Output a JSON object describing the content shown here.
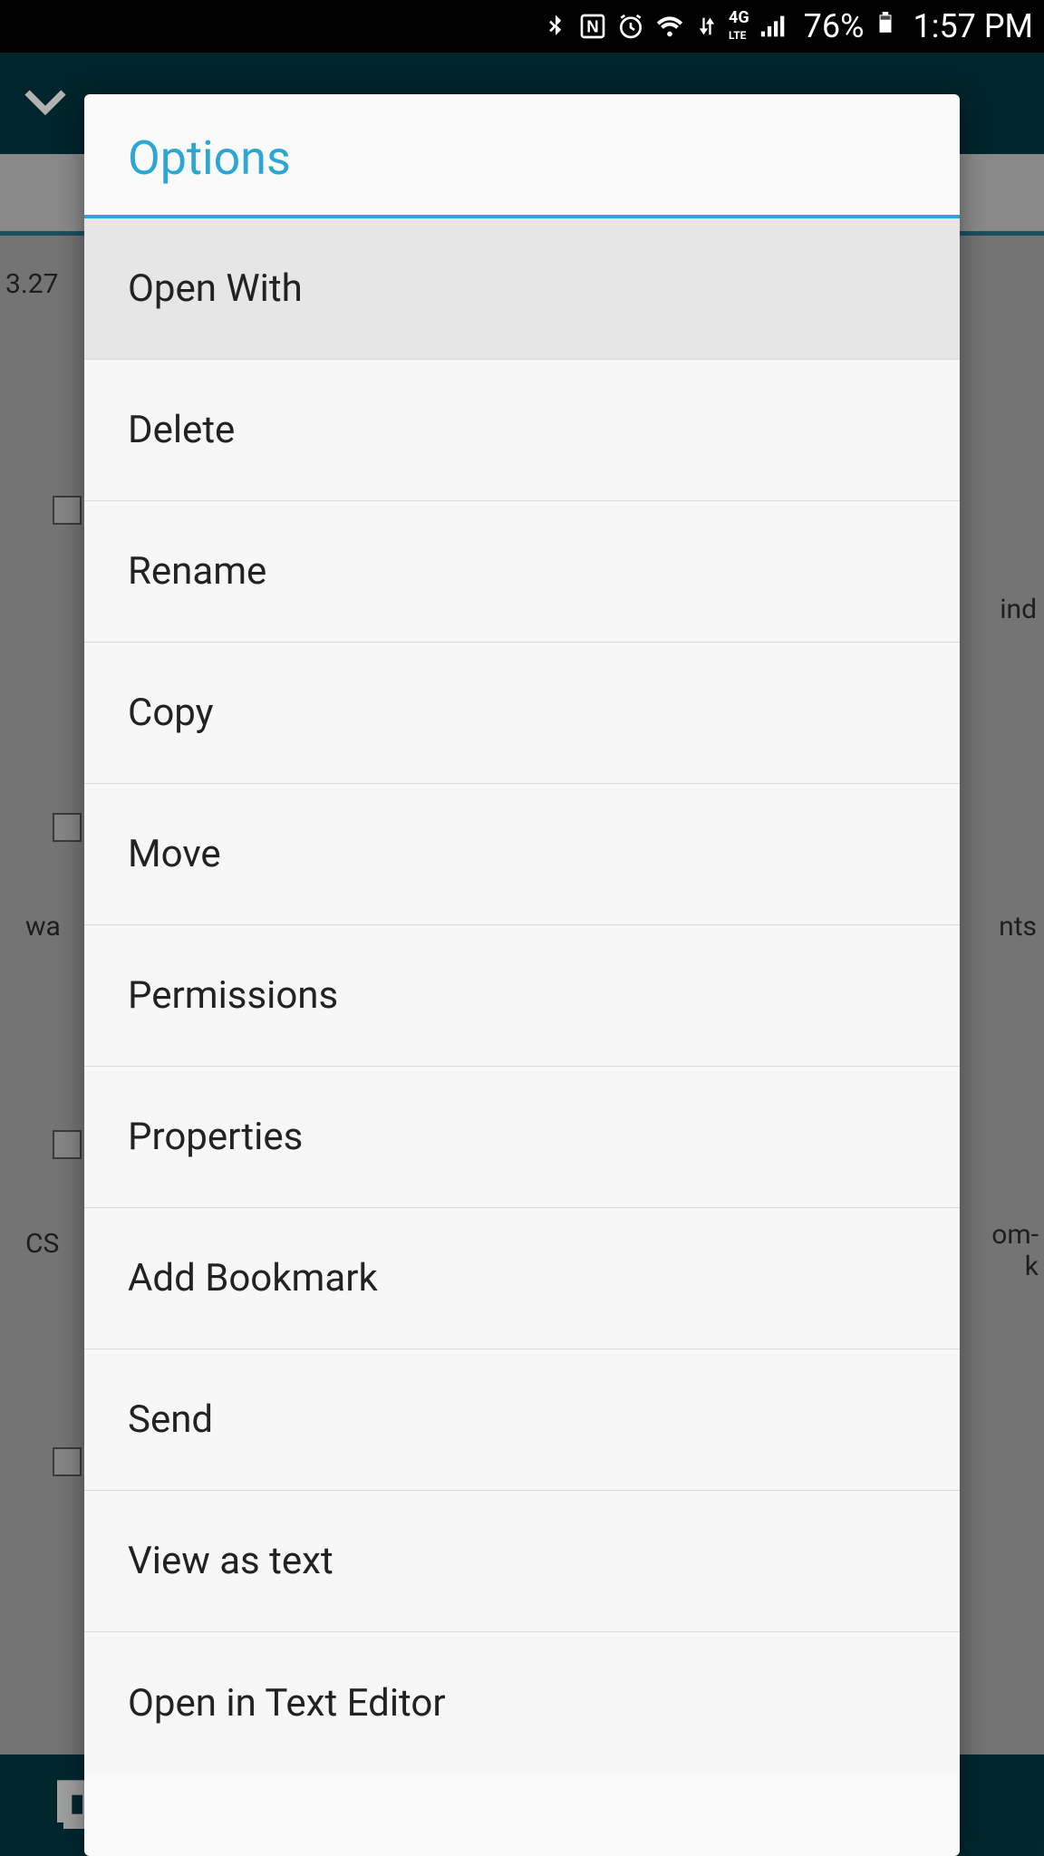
{
  "statusbar": {
    "battery_pct": "76%",
    "time": "1:57 PM",
    "network_label": "4G",
    "icons": {
      "bluetooth": "bluetooth",
      "nfc": "N",
      "alarm": "alarm",
      "wifi": "wifi",
      "data": "data-arrows",
      "signal": "cell-signal",
      "battery": "battery"
    }
  },
  "background": {
    "size_text": "3.27",
    "right1": "ind",
    "label1": "wa",
    "right2": "nts",
    "label2": "CS",
    "right3a": "om-",
    "right3b": "k"
  },
  "dialog": {
    "title": "Options",
    "items": [
      {
        "label": "Open With",
        "highlight": true
      },
      {
        "label": "Delete"
      },
      {
        "label": "Rename"
      },
      {
        "label": "Copy"
      },
      {
        "label": "Move"
      },
      {
        "label": "Permissions"
      },
      {
        "label": "Properties"
      },
      {
        "label": "Add Bookmark"
      },
      {
        "label": "Send"
      },
      {
        "label": "View as text"
      },
      {
        "label": "Open in Text Editor"
      }
    ]
  }
}
